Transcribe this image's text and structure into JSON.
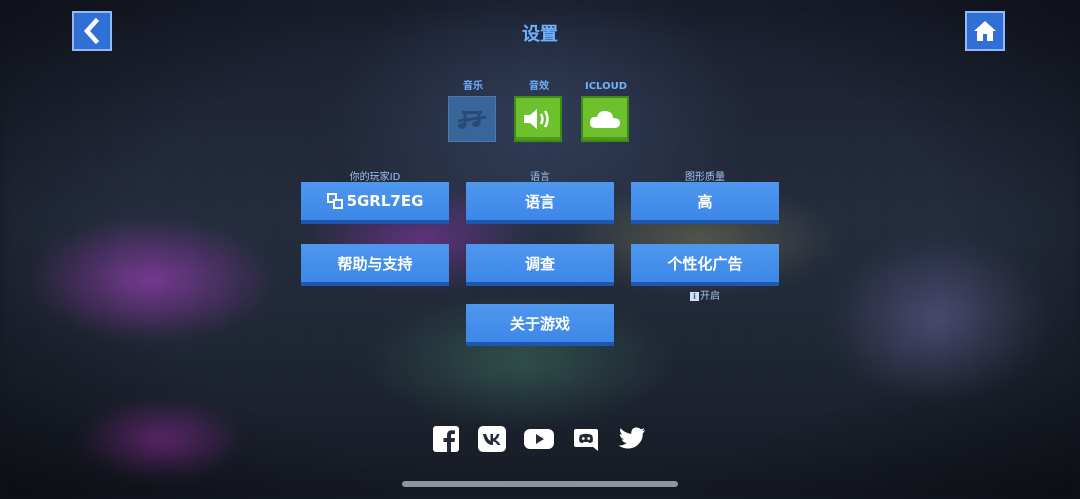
{
  "header": {
    "title": "设置",
    "back_icon": "chevron-left-icon",
    "home_icon": "home-icon"
  },
  "toggles": [
    {
      "label": "音乐",
      "icon": "music-muted-icon",
      "state": "off"
    },
    {
      "label": "音效",
      "icon": "speaker-icon",
      "state": "on"
    },
    {
      "label": "ICLOUD",
      "icon": "cloud-icon",
      "state": "on"
    }
  ],
  "settings": {
    "player_id_label": "你的玩家ID",
    "player_id": "5GRL7EG",
    "language_label": "语言",
    "language_button": "语言",
    "graphics_label": "图形质量",
    "graphics_value": "高",
    "help_button": "帮助与支持",
    "survey_button": "调查",
    "ads_button": "个性化广告",
    "ads_status": "开启",
    "about_button": "关于游戏"
  },
  "social": [
    "facebook-icon",
    "vk-icon",
    "youtube-icon",
    "discord-icon",
    "twitter-icon"
  ],
  "colors": {
    "accent": "#3c87e8",
    "title": "#6fb0ff",
    "toggle_on": "#6cc12c",
    "toggle_off": "#3c6fa8"
  }
}
